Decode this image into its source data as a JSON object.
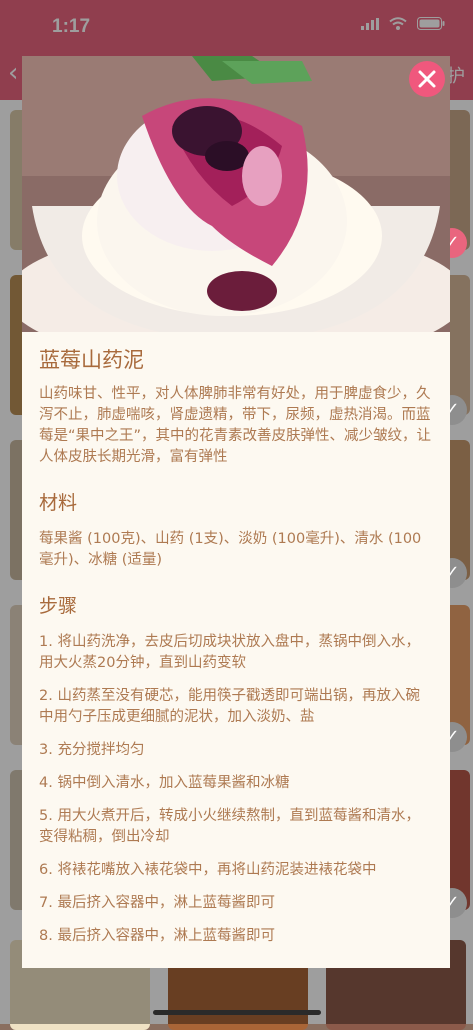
{
  "status": {
    "time": "1:17"
  },
  "navbar": {
    "back_icon": "chevron-left-icon",
    "right_text": "护"
  },
  "recipe": {
    "title": "蓝莓山药泥",
    "description": "山药味甘、性平，对人体脾肺非常有好处，用于脾虚食少，久泻不止，肺虚喘咳，肾虚遗精，带下，尿频，虚热消渴。而蓝莓是“果中之王”，其中的花青素改善皮肤弹性、减少皱纹，让人体皮肤长期光滑，富有弹性",
    "materials_heading": "材料",
    "materials": "莓果酱 (100克)、山药 (1支)、淡奶 (100毫升)、清水 (100毫升)、冰糖 (适量)",
    "steps_heading": "步骤",
    "steps": [
      "1. 将山药洗净，去皮后切成块状放入盘中，蒸锅中倒入水，用大火蒸20分钟，直到山药变软",
      "2. 山药蒸至没有硬芯，能用筷子戳透即可端出锅，再放入碗中用勺子压成更细腻的泥状，加入淡奶、盐",
      "3. 充分搅拌均匀",
      "4. 锅中倒入清水，加入蓝莓果酱和冰糖",
      "5. 用大火煮开后，转成小火继续熬制，直到蓝莓酱和清水，变得粘稠，倒出冷却",
      "6. 将裱花嘴放入裱花袋中，再将山药泥装进裱花袋中",
      "7. 最后挤入容器中，淋上蓝莓酱即可",
      "8. 最后挤入容器中，淋上蓝莓酱即可"
    ]
  },
  "colors": {
    "accent": "#e9657e",
    "close_button": "#f0587d",
    "text": "#ae7a52"
  },
  "icons": {
    "close": "close-icon",
    "check": "check-icon",
    "wifi": "wifi-icon",
    "battery": "battery-icon"
  }
}
